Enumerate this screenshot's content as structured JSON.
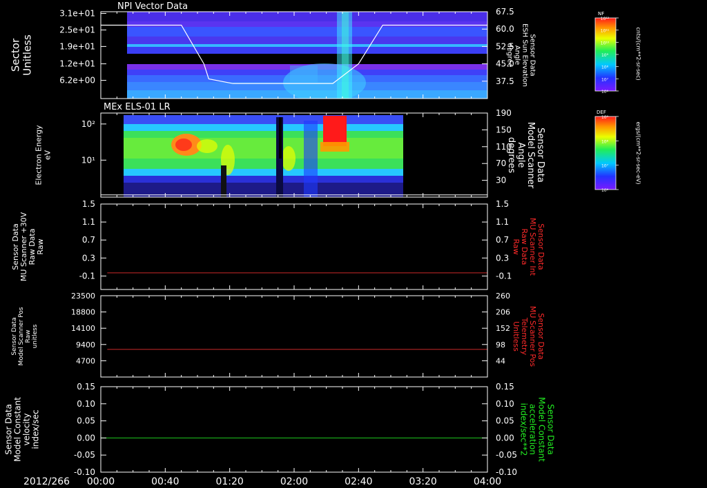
{
  "colors": {
    "axis": "#ffffff",
    "red_trace": "#cc2a2a",
    "green_trace": "#1fcc1f",
    "red_label": "#ff2a2a",
    "green_label": "#22ee22"
  },
  "time_axis": {
    "date": "2012/266",
    "ticks": [
      "00:00",
      "00:40",
      "01:20",
      "02:00",
      "02:40",
      "03:20",
      "04:00"
    ],
    "range_minutes": [
      0,
      240
    ]
  },
  "chart_data": [
    {
      "type": "heatmap",
      "title": "NPI Vector Data",
      "ylabel": [
        "Sector",
        "Unitless"
      ],
      "y_ticks": [
        "3.1e+01",
        "2.5e+01",
        "1.9e+01",
        "1.2e+01",
        "6.2e+00"
      ],
      "right_ylabel": [
        "Sensor Data",
        "ESH Sun Elevation",
        "Angle",
        "degree"
      ],
      "right_ticks": [
        "67.5",
        "60.0",
        "52.5",
        "45.0",
        "37.5"
      ],
      "right_ylim": [
        30,
        67.5
      ],
      "data_start_minute": 13,
      "overlay_line": {
        "x_minutes": [
          0,
          13,
          50,
          64,
          67,
          82,
          144,
          160,
          175,
          240
        ],
        "y": [
          61.7,
          61.7,
          61.7,
          45,
          38.5,
          36.5,
          36.5,
          45,
          61.7,
          61.7
        ]
      },
      "colorbar": {
        "label": "NF",
        "units": "cnts/(cm**2-sr-sec)",
        "tick_labels": [
          "10¹²",
          "10¹¹",
          "10¹⁰",
          "10⁹",
          "10⁸",
          "10⁷",
          "10⁶"
        ]
      }
    },
    {
      "type": "heatmap",
      "title": "MEx ELS-01 LR",
      "ylabel": [
        "Electron Energy",
        "eV"
      ],
      "y_ticks": [
        "10²",
        "10¹"
      ],
      "right_ylabel": [
        "Sensor Data",
        "Model Scanner",
        "Angle",
        "degrees"
      ],
      "right_ticks": [
        "190",
        "150",
        "110",
        "70",
        "30"
      ],
      "data_minutes": [
        10,
        187
      ],
      "overlay_line": {
        "y": 5
      },
      "colorbar": {
        "label": "DEF",
        "units": "ergs/(cm**2-sr-sec-eV)",
        "tick_labels": [
          "10⁹",
          "10⁸",
          "10⁷",
          "10⁶"
        ]
      }
    },
    {
      "type": "line",
      "ylabel": [
        "Sensor Data",
        "MU Scanner +30V",
        "Raw Data",
        "Raw"
      ],
      "y_ticks": [
        "1.5",
        "1.1",
        "0.7",
        "0.3",
        "-0.1"
      ],
      "ylim": [
        -0.4,
        1.5
      ],
      "right_ylabel": [
        "Sensor Data",
        "MU Scanner Int",
        "Raw Data",
        "Raw"
      ],
      "right_ticks": [
        "1.5",
        "1.1",
        "0.7",
        "0.3",
        "-0.1"
      ],
      "series": [
        {
          "x_minutes": [
            4,
            240
          ],
          "values": [
            -0.03,
            -0.03
          ]
        }
      ]
    },
    {
      "type": "line",
      "ylabel": [
        "Sensor Data",
        "Model Scanner Pos",
        "Raw",
        "unitless"
      ],
      "y_ticks": [
        "23500",
        "18800",
        "14100",
        "9400",
        "4700"
      ],
      "ylim": [
        0,
        23500
      ],
      "right_ylabel": [
        "Sensor Data",
        "MU Scanner Pos",
        "Telemetry",
        "Unitless"
      ],
      "right_ticks": [
        "260",
        "206",
        "152",
        "98",
        "44"
      ],
      "series": [
        {
          "x_minutes": [
            4,
            240
          ],
          "values": [
            8000,
            8000
          ]
        }
      ]
    },
    {
      "type": "line",
      "ylabel": [
        "Sensor Data",
        "Model Constant",
        "velocity",
        "index/sec"
      ],
      "y_ticks": [
        "0.15",
        "0.10",
        "0.05",
        "0.00",
        "-0.05",
        "-0.10"
      ],
      "ylim": [
        -0.1,
        0.15
      ],
      "right_ylabel": [
        "Sensor Data",
        "Model Constant",
        "acceleration",
        "index/sec**2"
      ],
      "right_ticks": [
        "0.15",
        "0.10",
        "0.05",
        "0.00",
        "-0.05",
        "-0.10"
      ],
      "series": [
        {
          "x_minutes": [
            0,
            240
          ],
          "values": [
            0.0,
            0.0
          ]
        }
      ]
    }
  ]
}
